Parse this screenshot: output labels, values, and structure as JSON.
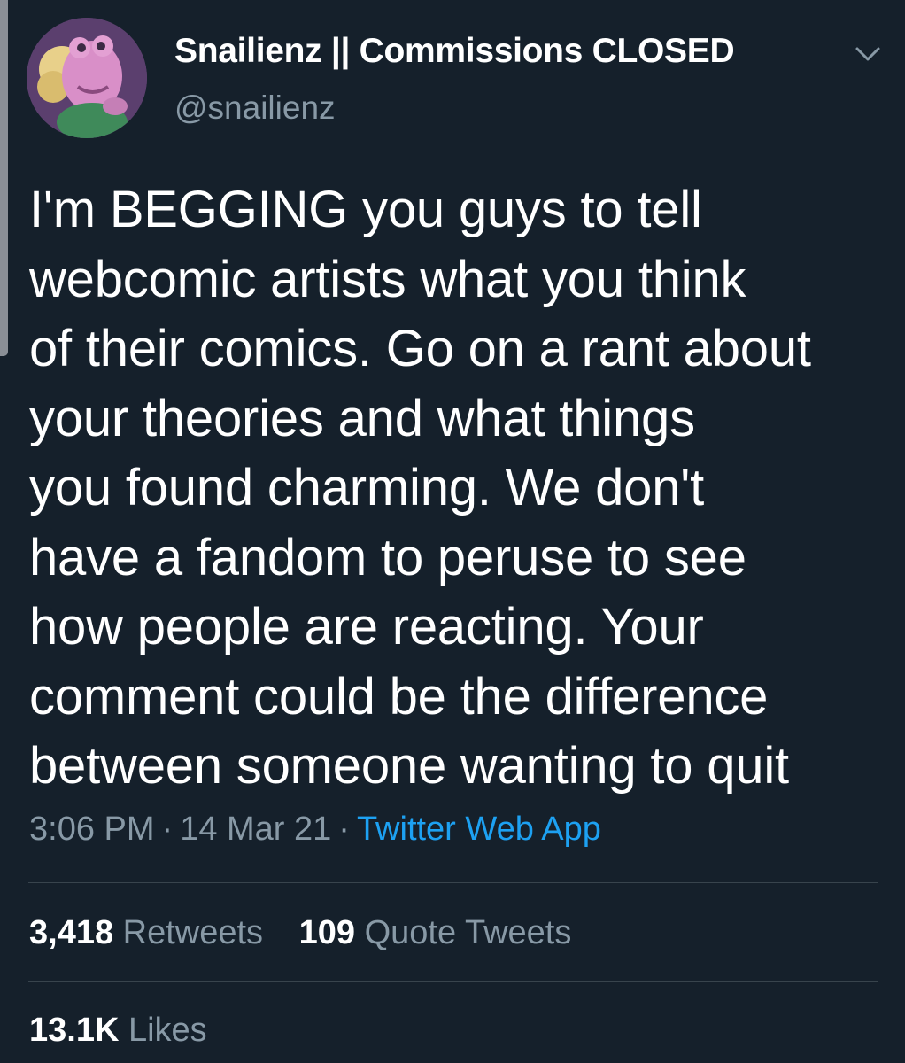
{
  "author": {
    "display_name": "Snailienz || Commissions CLOSED",
    "handle": "@snailienz"
  },
  "tweet": {
    "lines": [
      "I'm BEGGING you guys to tell",
      "webcomic artists what you think",
      "of their comics. Go on a rant about",
      "your theories and what things",
      "you found charming. We don't",
      "have a fandom to peruse to see",
      "how people are reacting. Your",
      "comment could be the difference",
      "between someone wanting to quit"
    ],
    "time": "3:06 PM",
    "separator": "·",
    "date": "14 Mar 21",
    "source": "Twitter Web App"
  },
  "stats": {
    "retweets_count": "3,418",
    "retweets_label": "Retweets",
    "quotes_count": "109",
    "quotes_label": "Quote Tweets",
    "likes_count": "13.1K",
    "likes_label": "Likes"
  },
  "colors": {
    "background": "#15202b",
    "text": "#ffffff",
    "secondary_text": "#8899a6",
    "link": "#1da1f2",
    "divider": "#38444d"
  },
  "icons": {
    "menu": "chevron-down-icon"
  }
}
